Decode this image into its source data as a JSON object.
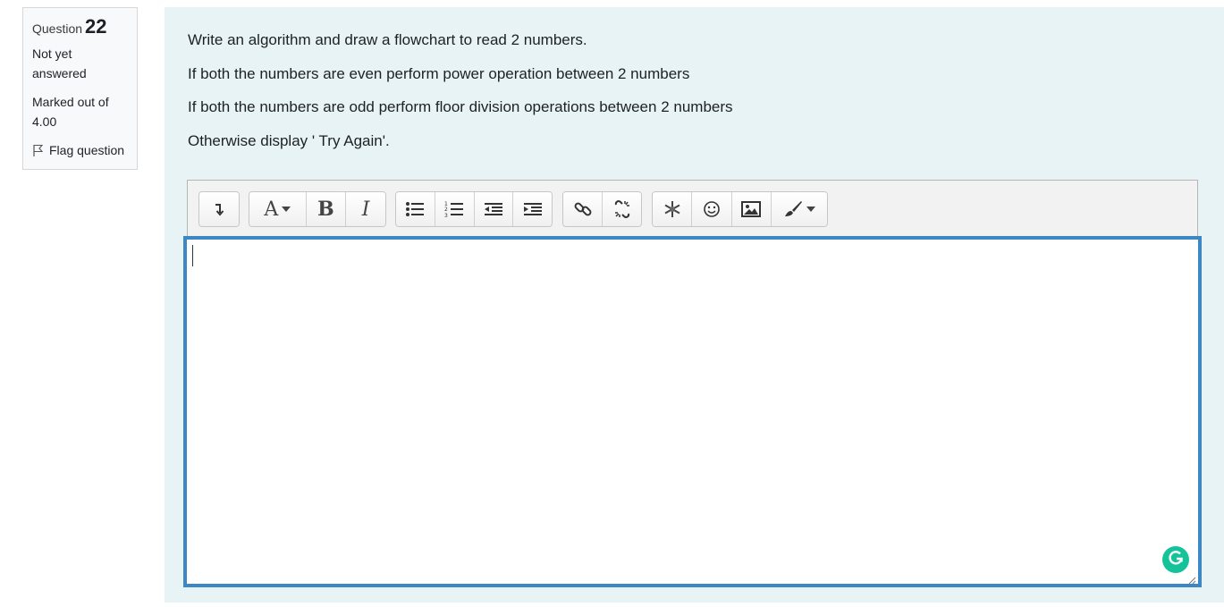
{
  "info": {
    "question_label": "Question",
    "question_number": "22",
    "state": "Not yet answered",
    "grade": "Marked out of 4.00",
    "flag_label": "Flag question"
  },
  "question": {
    "lines": [
      "Write an algorithm and draw a flowchart to read 2 numbers.",
      "If both the numbers are even perform power operation between 2 numbers",
      "If both the numbers are odd perform floor division operations between 2 numbers",
      "Otherwise display ' Try Again'."
    ]
  },
  "toolbar": {
    "font_button": "A",
    "bold_button": "B",
    "italic_button": "I"
  },
  "colors": {
    "content_bg": "#e7f3f5",
    "editor_focus_border": "#3d87c4",
    "grammarly": "#15c39a"
  }
}
